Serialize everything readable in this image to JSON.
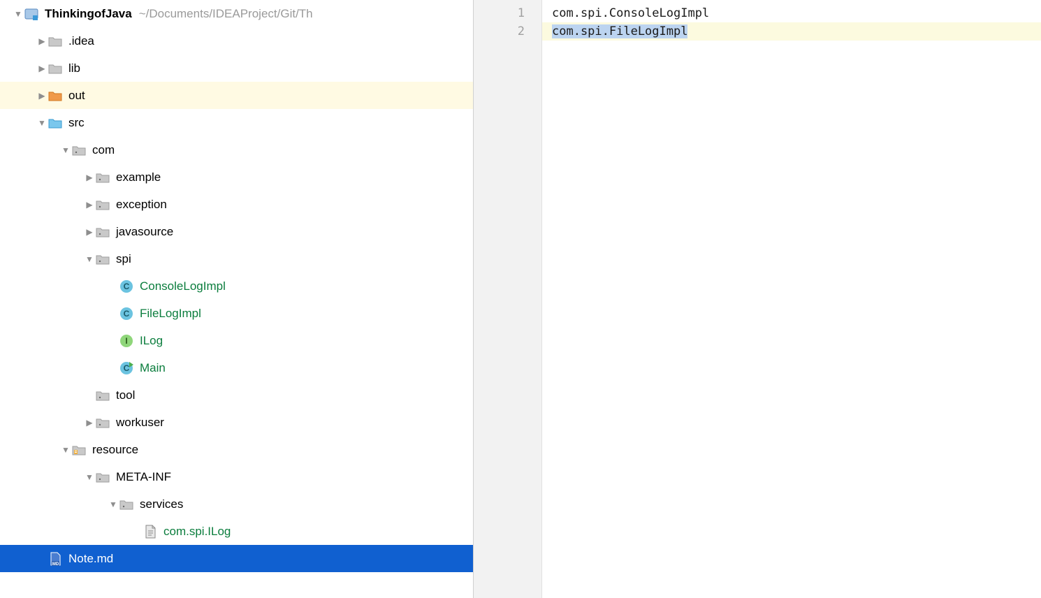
{
  "project": {
    "name": "ThinkingofJava",
    "path": "~/Documents/IDEAProject/Git/Th"
  },
  "tree": [
    {
      "id": "root",
      "indent": 0,
      "arrow": "down",
      "icon": "module",
      "label": "ThinkingofJava",
      "bold": true,
      "pathHint": true
    },
    {
      "id": "idea",
      "indent": 1,
      "arrow": "right",
      "icon": "folder-gray",
      "label": ".idea"
    },
    {
      "id": "lib",
      "indent": 1,
      "arrow": "right",
      "icon": "folder-gray",
      "label": "lib"
    },
    {
      "id": "out",
      "indent": 1,
      "arrow": "right",
      "icon": "folder-orange",
      "label": "out",
      "rowClass": "highlighted-yellow"
    },
    {
      "id": "src",
      "indent": 1,
      "arrow": "down",
      "icon": "folder-blue",
      "label": "src"
    },
    {
      "id": "com",
      "indent": 2,
      "arrow": "down",
      "icon": "package",
      "label": "com"
    },
    {
      "id": "example",
      "indent": 3,
      "arrow": "right",
      "icon": "package",
      "label": "example"
    },
    {
      "id": "exception",
      "indent": 3,
      "arrow": "right",
      "icon": "package",
      "label": "exception"
    },
    {
      "id": "javasource",
      "indent": 3,
      "arrow": "right",
      "icon": "package",
      "label": "javasource"
    },
    {
      "id": "spi",
      "indent": 3,
      "arrow": "down",
      "icon": "package",
      "label": "spi"
    },
    {
      "id": "consolelogimpl",
      "indent": 4,
      "arrow": "none",
      "icon": "class-c",
      "label": "ConsoleLogImpl",
      "green": true
    },
    {
      "id": "filelogimpl",
      "indent": 4,
      "arrow": "none",
      "icon": "class-c",
      "label": "FileLogImpl",
      "green": true
    },
    {
      "id": "ilog",
      "indent": 4,
      "arrow": "none",
      "icon": "interface-i",
      "label": "ILog",
      "green": true
    },
    {
      "id": "main",
      "indent": 4,
      "arrow": "none",
      "icon": "class-c-run",
      "label": "Main",
      "green": true
    },
    {
      "id": "tool",
      "indent": 3,
      "arrow": "none",
      "icon": "package",
      "label": "tool"
    },
    {
      "id": "workuser",
      "indent": 3,
      "arrow": "right",
      "icon": "package",
      "label": "workuser"
    },
    {
      "id": "resource",
      "indent": 2,
      "arrow": "down",
      "icon": "resource-folder",
      "label": "resource"
    },
    {
      "id": "metainf",
      "indent": 3,
      "arrow": "down",
      "icon": "package",
      "label": "META-INF"
    },
    {
      "id": "services",
      "indent": 4,
      "arrow": "down",
      "icon": "package",
      "label": "services"
    },
    {
      "id": "comspiilog",
      "indent": 5,
      "arrow": "none",
      "icon": "file",
      "label": "com.spi.ILog",
      "green": true
    },
    {
      "id": "notemd",
      "indent": 1,
      "arrow": "none",
      "icon": "md-file",
      "label": "Note.md",
      "rowClass": "selected"
    }
  ],
  "editor": {
    "lines": [
      {
        "num": "1",
        "text": "com.spi.ConsoleLogImpl"
      },
      {
        "num": "2",
        "text": "com.spi.FileLogImpl",
        "current": true,
        "selected": true
      }
    ]
  },
  "icons": {
    "module": "module-icon",
    "folder-gray": "folder-icon",
    "folder-orange": "folder-icon",
    "folder-blue": "folder-icon",
    "package": "package-icon",
    "class-c": "class-icon",
    "class-c-run": "class-run-icon",
    "interface-i": "interface-icon",
    "resource-folder": "resource-folder-icon",
    "file": "file-icon",
    "md-file": "markdown-file-icon"
  }
}
